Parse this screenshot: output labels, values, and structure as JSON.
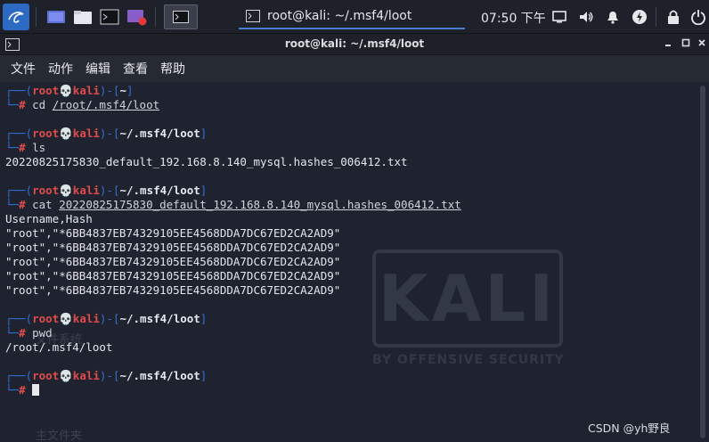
{
  "taskbar": {
    "window_title": "root@kali: ~/.msf4/loot",
    "clock": "07:50 下午"
  },
  "window": {
    "title": "root@kali: ~/.msf4/loot",
    "menu": [
      "文件",
      "动作",
      "编辑",
      "查看",
      "帮助"
    ]
  },
  "prompt": {
    "user": "root",
    "skull": "💀",
    "host": "kali"
  },
  "blocks": [
    {
      "path": "~",
      "command": "cd",
      "arg": "/root/.msf4/loot"
    },
    {
      "path": "~/.msf4/loot",
      "command": "ls",
      "output": [
        "20220825175830_default_192.168.8.140_mysql.hashes_006412.txt"
      ]
    },
    {
      "path": "~/.msf4/loot",
      "command": "cat",
      "arg": "20220825175830_default_192.168.8.140_mysql.hashes_006412.txt",
      "output": [
        "Username,Hash",
        "\"root\",\"*6BB4837EB74329105EE4568DDA7DC67ED2CA2AD9\"",
        "\"root\",\"*6BB4837EB74329105EE4568DDA7DC67ED2CA2AD9\"",
        "\"root\",\"*6BB4837EB74329105EE4568DDA7DC67ED2CA2AD9\"",
        "\"root\",\"*6BB4837EB74329105EE4568DDA7DC67ED2CA2AD9\"",
        "\"root\",\"*6BB4837EB74329105EE4568DDA7DC67ED2CA2AD9\""
      ]
    },
    {
      "path": "~/.msf4/loot",
      "command": "pwd",
      "output": [
        "/root/.msf4/loot"
      ]
    },
    {
      "path": "~/.msf4/loot",
      "command": ""
    }
  ],
  "watermark": {
    "logo": "KALI",
    "tagline": "BY OFFENSIVE SECURITY",
    "desktop_labels": [
      "文件系统",
      "主文件夹"
    ]
  },
  "footer": "CSDN @yh野良"
}
